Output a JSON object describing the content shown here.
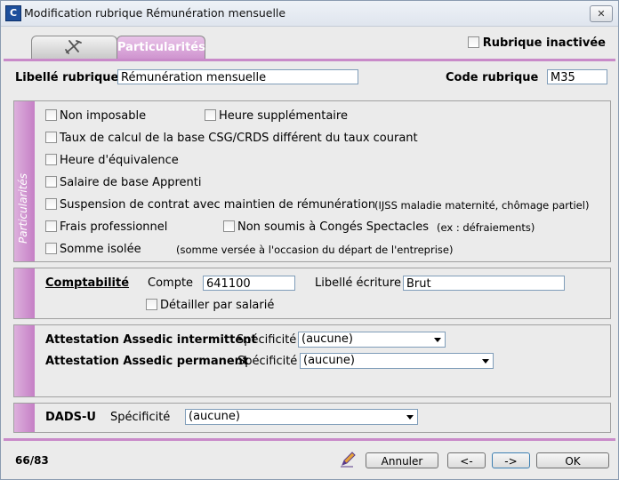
{
  "window": {
    "title": "Modification rubrique Rémunération mensuelle",
    "close_label": "✕",
    "app_icon_glyph": "C"
  },
  "tabs": [
    {
      "label": "",
      "icon": "tools-icon"
    },
    {
      "label": "Particularités",
      "active": true
    }
  ],
  "rubrique_inactive": {
    "label": "Rubrique inactivée",
    "checked": false
  },
  "header": {
    "libelle_label": "Libellé rubrique",
    "libelle_value": "Rémunération mensuelle",
    "code_label": "Code rubrique",
    "code_value": "M35"
  },
  "particularites": {
    "band_label": "Particularités",
    "options": {
      "non_imposable": "Non imposable",
      "heure_sup": "Heure supplémentaire",
      "taux_csg": "Taux de calcul de la base CSG/CRDS différent du taux courant",
      "heure_equivalence": "Heure d'équivalence",
      "salaire_apprenti": "Salaire de base Apprenti",
      "suspension": "Suspension de contrat avec maintien de rémunération",
      "suspension_hint": "(IJSS maladie maternité, chômage partiel)",
      "frais_pro": "Frais professionnel",
      "non_soumis_cs": "Non soumis à Congés Spectacles",
      "non_soumis_hint": "(ex : défraiements)",
      "somme_isolee": "Somme isolée",
      "somme_isolee_hint": "(somme versée à l'occasion du départ de l'entreprise)"
    }
  },
  "comptabilite": {
    "title": "Comptabilité",
    "compte_label": "Compte",
    "compte_value": "641100",
    "libelle_label": "Libellé écriture",
    "libelle_value": "Brut",
    "detail_label": "Détailler par salarié"
  },
  "assedic": {
    "intermittent_label": "Attestation Assedic intermittent",
    "intermittent_spec_label": "Spécificité",
    "intermittent_value": "(aucune)",
    "permanent_label": "Attestation Assedic permanent",
    "permanent_spec_label": "Spécificité",
    "permanent_value": "(aucune)"
  },
  "dads": {
    "label": "DADS-U",
    "spec_label": "Spécificité",
    "value": "(aucune)"
  },
  "footer": {
    "counter": "66/83",
    "annuler": "Annuler",
    "prev": "<-",
    "next": "->",
    "ok": "OK"
  },
  "colors": {
    "accent": "#c98ac9",
    "band": "#cf94cf"
  }
}
